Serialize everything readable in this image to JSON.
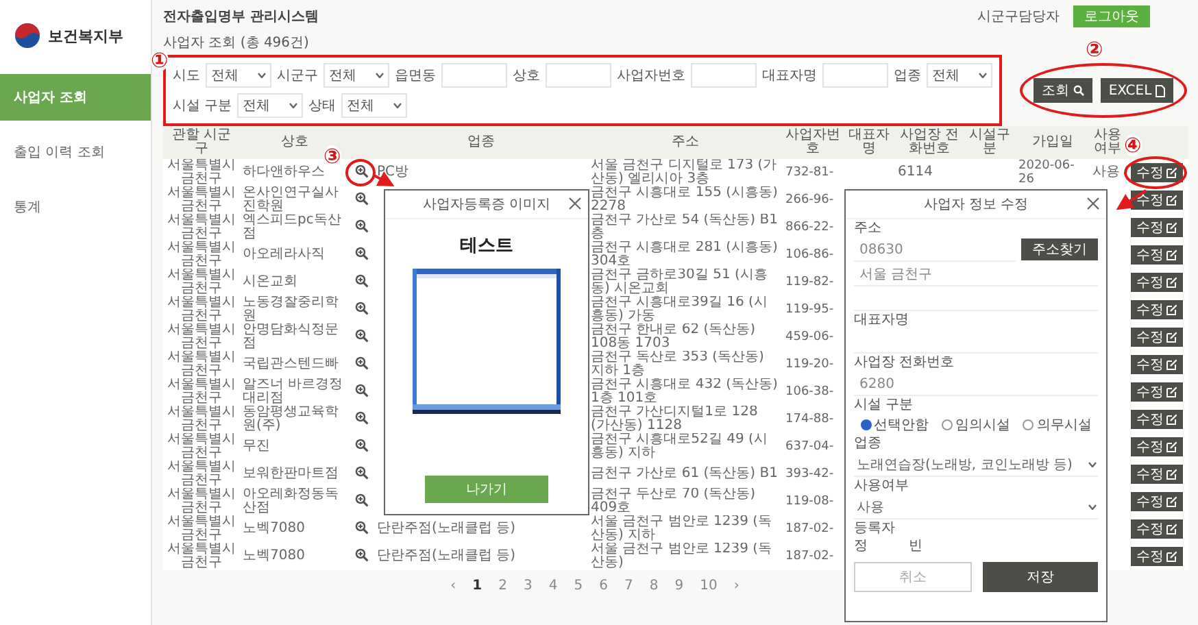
{
  "header": {
    "title": "전자출입명부 관리시스템",
    "user": "시군구담당자",
    "logout": "로그아웃"
  },
  "sidebar": {
    "logo": "보건복지부",
    "items": [
      {
        "label": "사업자 조회",
        "selected": true
      },
      {
        "label": "출입 이력 조회",
        "selected": false
      },
      {
        "label": "통계",
        "selected": false
      }
    ]
  },
  "page_title": "사업자 조회 (총 496건)",
  "filters": [
    [
      {
        "label": "시도",
        "kind": "select",
        "value": "전체"
      },
      {
        "label": "시군구",
        "kind": "select",
        "value": "전체"
      },
      {
        "label": "읍면동",
        "kind": "input"
      },
      {
        "label": "상호",
        "kind": "input"
      },
      {
        "label": "사업자번호",
        "kind": "input"
      },
      {
        "label": "대표자명",
        "kind": "input"
      },
      {
        "label": "업종",
        "kind": "select",
        "value": "전체"
      }
    ],
    [
      {
        "label": "시설 구분",
        "kind": "select",
        "value": "전체"
      },
      {
        "label": "상태",
        "kind": "select",
        "value": "전체"
      }
    ]
  ],
  "actions": [
    {
      "label": "조회",
      "kind": "search"
    },
    {
      "label": "EXCEL",
      "kind": "document"
    }
  ],
  "table": {
    "columns": [
      "관할 시군구",
      "상호",
      "업종",
      "주소",
      "사업자번호",
      "대표자명",
      "사업장 전화번호",
      "시설구분",
      "가입일",
      "사용여부"
    ],
    "rows": [
      {
        "district": "서울특별시 금천구",
        "name": "하다앤하우스",
        "business_type": "PC방",
        "address": "서울 금천구 디지털로 173 (가산동) 엘리시아 3층",
        "business_no": "732-81-",
        "phone": "6114",
        "joined": "2020-06-26",
        "status": "사용",
        "action": "수정"
      },
      {
        "district": "서울특별시 금천구",
        "name": "온사인연구실사진학원",
        "address": "금천구 시흥대로 155 (시흥동) 2278",
        "business_no": "266-96-",
        "action": "수정"
      },
      {
        "district": "서울특별시 금천구",
        "name": "엑스피드pc독산점",
        "address": "금천구 가산로 54 (독산동) B1층",
        "business_no": "866-22-",
        "action": "수정"
      },
      {
        "district": "서울특별시 금천구",
        "name": "아오레라사직",
        "address": "금천구 시흥대로 281 (시흥동) 304호",
        "business_no": "106-86-",
        "action": "수정"
      },
      {
        "district": "서울특별시 금천구",
        "name": "시온교회",
        "address": "금천구 금하로30길 51 (시흥동) 시온교회",
        "business_no": "119-82-",
        "action": "수정"
      },
      {
        "district": "서울특별시 금천구",
        "name": "노동경찰중리학원",
        "address": "금천구 시흥대로39길 16 (시흥동) 가동",
        "business_no": "119-95-",
        "action": "수정"
      },
      {
        "district": "서울특별시 금천구",
        "name": "안명담화식정문점",
        "address": "금천구 한내로 62 (독산동) 108동 1703",
        "business_no": "459-06-",
        "action": "수정"
      },
      {
        "district": "서울특별시 금천구",
        "name": "국립관스텐드빠",
        "address": "금천구 독산로 353 (독산동) 지하 1층",
        "business_no": "119-20-",
        "action": "수정"
      },
      {
        "district": "서울특별시 금천구",
        "name": "알즈너 바르경정대리점",
        "address": "금천구 시흥대로 432 (독산동) 1층 101호",
        "business_no": "106-38-",
        "action": "수정"
      },
      {
        "district": "서울특별시 금천구",
        "name": "동암평생교육학원(주)",
        "address": "금천구 가산디지털1로 128 (가산동) 1128",
        "business_no": "174-88-",
        "action": "수정"
      },
      {
        "district": "서울특별시 금천구",
        "name": "무진",
        "address": "금천구 시흥대로52길 49 (시흥동) 지하",
        "business_no": "637-04-",
        "action": "수정"
      },
      {
        "district": "서울특별시 금천구",
        "name": "보워한판마트점",
        "address": "금천구 가산로 61 (독산동) B1",
        "business_no": "393-42-",
        "action": "수정"
      },
      {
        "district": "서울특별시 금천구",
        "name": "아오레화정동독산점",
        "address": "금천구 두산로 70 (독산동) 409호",
        "business_no": "119-08-",
        "action": "수정"
      },
      {
        "district": "서울특별시 금천구",
        "name": "노벡7080",
        "business_type": "단란주점(노래클럽 등)",
        "address": "서울 금천구 범안로 1239 (독산동) 지하",
        "business_no": "187-02-",
        "action": "수정"
      },
      {
        "district": "서울특별시 금천구",
        "name": "노벡7080",
        "business_type": "단란주점(노래클럽 등)",
        "address": "서울 금천구 범안로 1239 (독산동)",
        "business_no": "187-02-",
        "action": "수정"
      }
    ]
  },
  "pagination": {
    "prev": "‹",
    "next": "›",
    "pages": [
      {
        "label": "1",
        "selected": true
      },
      {
        "label": "2",
        "selected": false
      },
      {
        "label": "3",
        "selected": false
      },
      {
        "label": "4",
        "selected": false
      },
      {
        "label": "5",
        "selected": false
      },
      {
        "label": "6",
        "selected": false
      },
      {
        "label": "7",
        "selected": false
      },
      {
        "label": "8",
        "selected": false
      },
      {
        "label": "9",
        "selected": false
      },
      {
        "label": "10",
        "selected": false
      }
    ]
  },
  "image_modal": {
    "title": "사업자등록증 이미지",
    "heading": "테스트",
    "button": "나가기"
  },
  "edit_modal": {
    "title": "사업자 정보 수정",
    "address_label": "주소",
    "postcode": "08630",
    "find_button": "주소찾기",
    "address": "서울 금천구",
    "representative_label": "대표자명",
    "phone_label": "사업장 전화번호",
    "phone": "6280",
    "facility_label": "시설 구분",
    "facility_options": [
      {
        "label": "선택안함",
        "selected": true
      },
      {
        "label": "임의시설",
        "selected": false
      },
      {
        "label": "의무시설",
        "selected": false
      }
    ],
    "type_label": "업종",
    "type": "노래연습장(노래방, 코인노래방 등)",
    "status_label": "사용여부",
    "status": "사용",
    "registrant_label": "등록자",
    "registrant": [
      "정",
      "빈"
    ],
    "buttons": [
      {
        "label": "취소",
        "kind": "secondary"
      },
      {
        "label": "저장",
        "kind": "primary"
      }
    ]
  },
  "annotations": [
    "①",
    "②",
    "③",
    "④"
  ]
}
